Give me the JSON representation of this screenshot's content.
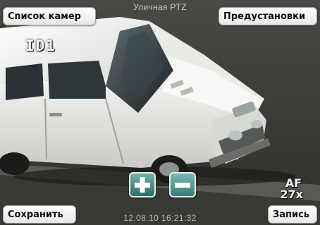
{
  "header": {
    "title": "Уличная PTZ",
    "camera_list_label": "Список камер",
    "presets_label": "Предустановки"
  },
  "overlay": {
    "camera_id": "ID1",
    "af_label": "AF",
    "zoom_level": "27x",
    "timestamp": "12.08.10 16:21:32"
  },
  "zoom_controls": {
    "zoom_in_icon": "plus-icon",
    "zoom_out_icon": "minus-icon"
  },
  "footer": {
    "save_label": "Сохранить",
    "record_label": "Запись"
  },
  "video": {
    "subject": "white car parked on street",
    "accent_colors": {
      "car": "#eceeea",
      "asphalt": "#3a3a36",
      "zoom_button": "#3f8a82"
    }
  }
}
